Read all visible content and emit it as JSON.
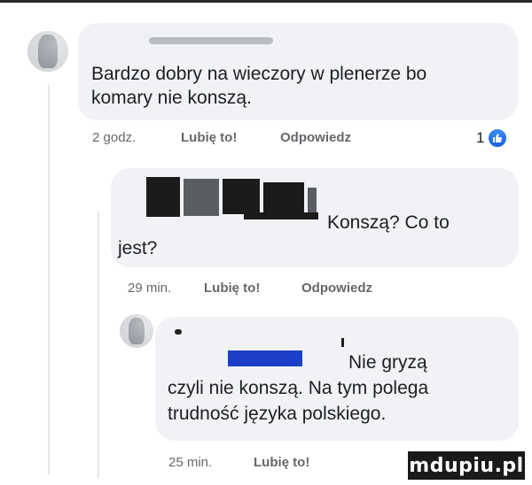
{
  "comments": [
    {
      "text_line1": "Bardzo dobry na wieczory w plenerze bo",
      "text_line2": "komary nie konszą.",
      "time": "2 godz.",
      "like_label": "Lubię to!",
      "reply_label": "Odpowiedz",
      "reaction_count": "1"
    },
    {
      "text_line1": "Konszą? Co to",
      "text_line2": "jest?",
      "time": "29 min.",
      "like_label": "Lubię to!",
      "reply_label": "Odpowiedz"
    },
    {
      "text_line1": "Nie gryzą",
      "text_line2": "czyli nie konszą. Na tym polega",
      "text_line3": "trudność języka polskiego.",
      "time": "25 min.",
      "like_label": "Lubię to!"
    }
  ],
  "watermark": "mdupiu.pl",
  "colors": {
    "bubble": "#f0f2f5",
    "meta": "#65676b",
    "like_blue": "#1663e0",
    "text": "#1c1e21"
  },
  "icons": {
    "reaction": "like-thumb-icon"
  }
}
